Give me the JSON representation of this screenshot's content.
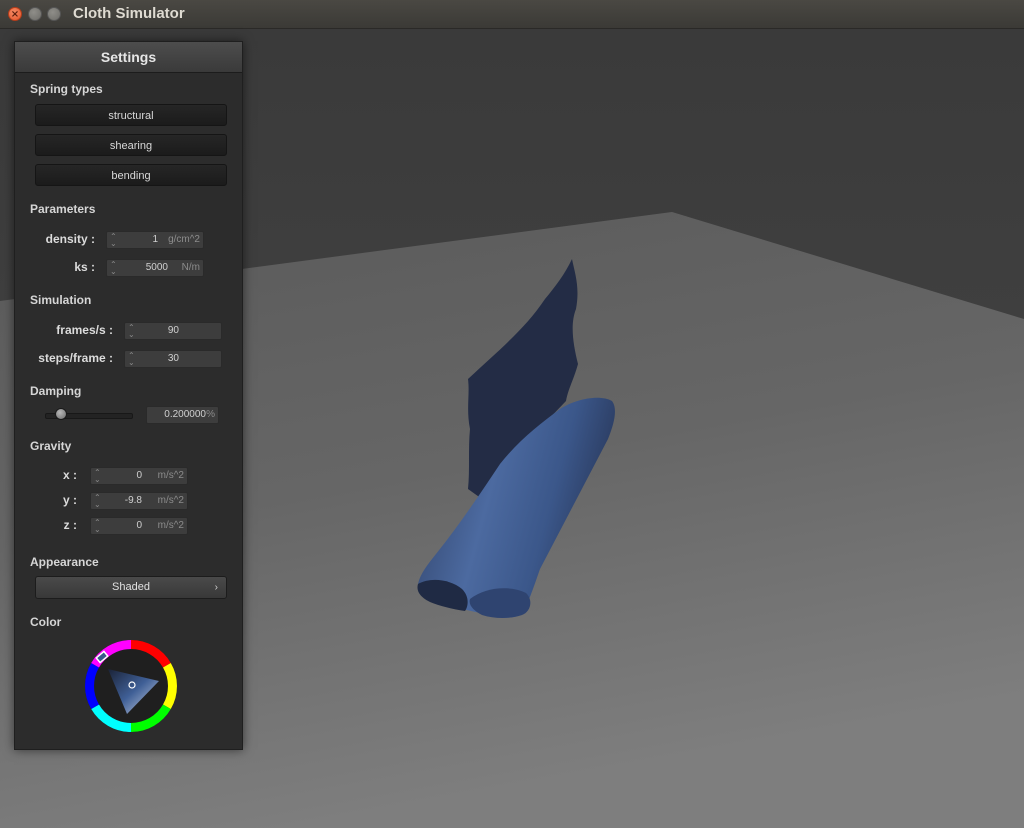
{
  "window": {
    "title": "Cloth Simulator"
  },
  "panel": {
    "title": "Settings",
    "spring_types": {
      "heading": "Spring types",
      "buttons": [
        "structural",
        "shearing",
        "bending"
      ]
    },
    "parameters": {
      "heading": "Parameters",
      "density": {
        "label": "density :",
        "value": "1",
        "unit": "g/cm^2"
      },
      "ks": {
        "label": "ks :",
        "value": "5000",
        "unit": "N/m"
      }
    },
    "simulation": {
      "heading": "Simulation",
      "fps": {
        "label": "frames/s :",
        "value": "90"
      },
      "steps": {
        "label": "steps/frame :",
        "value": "30"
      }
    },
    "damping": {
      "heading": "Damping",
      "value": "0.200000",
      "unit": "%",
      "slider_level": 0.2
    },
    "gravity": {
      "heading": "Gravity",
      "x": {
        "label": "x :",
        "value": "0",
        "unit": "m/s^2"
      },
      "y": {
        "label": "y :",
        "value": "-9.8",
        "unit": "m/s^2"
      },
      "z": {
        "label": "z :",
        "value": "0",
        "unit": "m/s^2"
      }
    },
    "appearance": {
      "heading": "Appearance",
      "mode": "Shaded"
    },
    "color": {
      "heading": "Color",
      "selected_hex": "#3a5a8c"
    }
  },
  "colors": {
    "cloth": "#3a5a8c",
    "cloth_dark": "#232c44",
    "floor": "#6a6a6a",
    "wall": "#444444"
  }
}
